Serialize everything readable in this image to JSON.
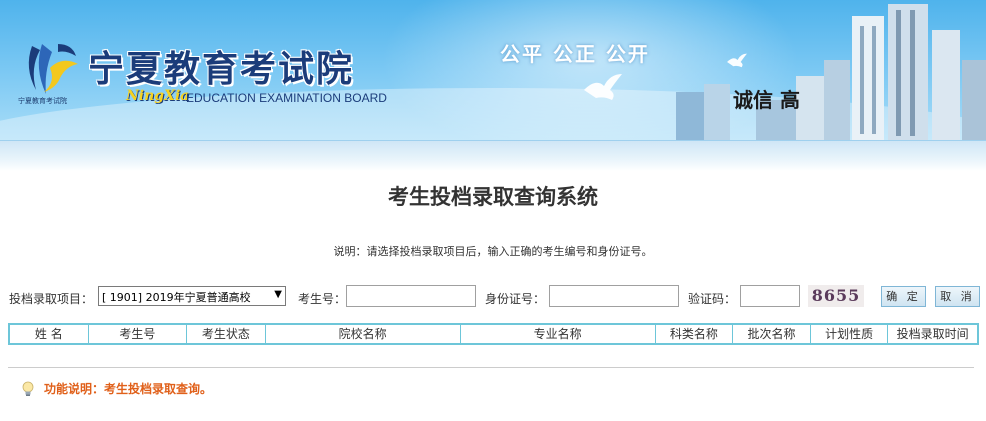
{
  "header": {
    "logo_tiny_text": "宁夏教育考试院",
    "site_name": "宁夏教育考试院",
    "site_name_en_script": "NingXia",
    "site_name_en": "EDUCATION EXAMINATION BOARD",
    "slogan": "公平 公正 公开",
    "slogan2": "诚信 高"
  },
  "page": {
    "title": "考生投档录取查询系统",
    "instruction": "说明：请选择投档录取项目后，输入正确的考生编号和身份证号。"
  },
  "form": {
    "project_label": "投档录取项目：",
    "project_selected": "[ 1901] 2019年宁夏普通高校",
    "exam_no_label": "考生号：",
    "exam_no_value": "",
    "id_label": "身份证号：",
    "id_value": "",
    "captcha_label": "验证码：",
    "captcha_value": "",
    "captcha_image_text": "8655",
    "confirm_label": "确 定",
    "cancel_label": "取 消"
  },
  "table": {
    "columns": [
      "姓 名",
      "考生号",
      "考生状态",
      "院校名称",
      "专业名称",
      "科类名称",
      "批次名称",
      "计划性质",
      "投档录取时间"
    ]
  },
  "footer": {
    "tip_text": "功能说明：考生投档录取查询。"
  },
  "colors": {
    "banner_blue": "#4fb3ec",
    "title_text": "#1b3c7a",
    "table_border": "#6dc6d9",
    "tip_orange": "#e0601a"
  },
  "icons": [
    "logo-emblem-icon",
    "dove-icon",
    "lightbulb-icon",
    "dropdown-arrow-icon"
  ]
}
